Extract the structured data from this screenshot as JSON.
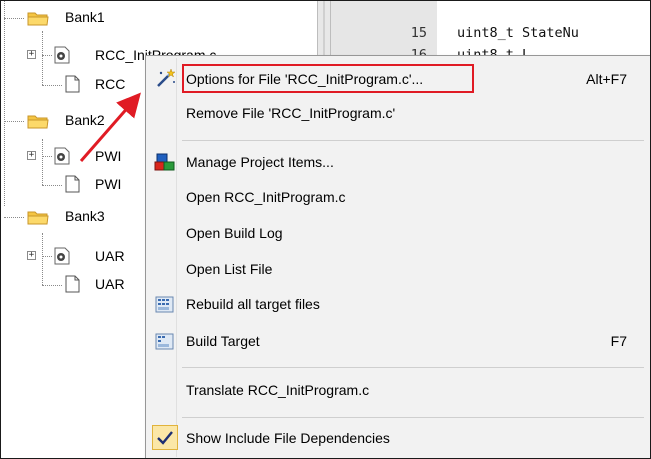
{
  "tree": {
    "groups": [
      {
        "name": "Bank1",
        "files": [
          "RCC_InitProgram.c",
          "RCC"
        ]
      },
      {
        "name": "Bank2",
        "files": [
          "PWI",
          "PWI"
        ]
      },
      {
        "name": "Bank3",
        "files": [
          "UAR",
          "UAR"
        ]
      }
    ]
  },
  "editor": {
    "lines": [
      {
        "number": "15",
        "code": "uint8_t StateNu"
      },
      {
        "number": "16",
        "code": "uint8_t L"
      }
    ]
  },
  "context_menu": {
    "items": [
      {
        "label": "Options for File 'RCC_InitProgram.c'...",
        "shortcut": "Alt+F7",
        "icon": "options-wand-icon"
      },
      {
        "label": "Remove File 'RCC_InitProgram.c'",
        "shortcut": "",
        "icon": ""
      },
      {
        "label": "Manage Project Items...",
        "shortcut": "",
        "icon": "manage-project-items-icon"
      },
      {
        "label": "Open RCC_InitProgram.c",
        "shortcut": "",
        "icon": ""
      },
      {
        "label": "Open Build Log",
        "shortcut": "",
        "icon": ""
      },
      {
        "label": "Open List File",
        "shortcut": "",
        "icon": ""
      },
      {
        "label": "Rebuild all target files",
        "shortcut": "",
        "icon": "rebuild-icon"
      },
      {
        "label": "Build Target",
        "shortcut": "F7",
        "icon": "build-icon"
      },
      {
        "label": "Translate RCC_InitProgram.c",
        "shortcut": "",
        "icon": ""
      },
      {
        "label": "Show Include File Dependencies",
        "shortcut": "",
        "icon": "checkmark-icon",
        "checked": true
      }
    ]
  },
  "annotation": {
    "highlight_color": "#e01b24",
    "arrow_color": "#e01b24"
  }
}
